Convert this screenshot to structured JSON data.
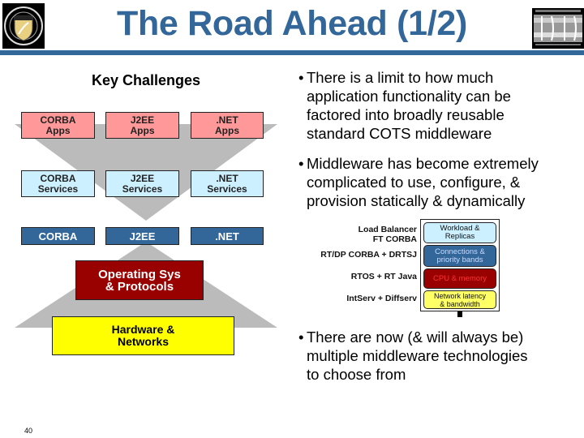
{
  "slide": {
    "title": "The Road Ahead (1/2)",
    "page_number": "40",
    "colors": {
      "title_blue": "#336699",
      "apps_fill": "#ff9999",
      "services_fill": "#ccf0ff",
      "middleware_fill": "#336699",
      "os_fill": "#990000",
      "hardware_fill": "#ffff00",
      "triangle_gray": "#bbbbbb"
    }
  },
  "logos": {
    "left": "university-seal-logo",
    "right": "isis-institute-logo"
  },
  "diagram": {
    "heading": "Key Challenges",
    "apps_row": [
      "CORBA\nApps",
      "J2EE\nApps",
      ".NET\nApps"
    ],
    "services_row": [
      "CORBA\nServices",
      "J2EE\nServices",
      ".NET\nServices"
    ],
    "middleware_row": [
      "CORBA",
      "J2EE",
      ".NET"
    ],
    "os_box": "Operating Sys\n& Protocols",
    "hardware_box": "Hardware &\nNetworks"
  },
  "bullets": [
    {
      "icon": "•",
      "text": "There is a limit to how much\napplication functionality can be\nfactored into broadly reusable\nstandard COTS middleware"
    },
    {
      "icon": "•",
      "text": "Middleware has become extremely\ncomplicated to use, configure, &\nprovision statically & dynamically"
    },
    {
      "icon": "•",
      "text": "There are now (& will always be)\nmultiple middleware technologies\nto choose from"
    }
  ],
  "qos_stack": {
    "labels": [
      "Load Balancer\nFT CORBA",
      "RT/DP CORBA + DRTSJ",
      "RTOS + RT Java",
      "IntServ + Diffserv"
    ],
    "layers": [
      "Workload &\nReplicas",
      "Connections &\npriority bands",
      "CPU & memory",
      "Network latency\n& bandwidth"
    ]
  }
}
